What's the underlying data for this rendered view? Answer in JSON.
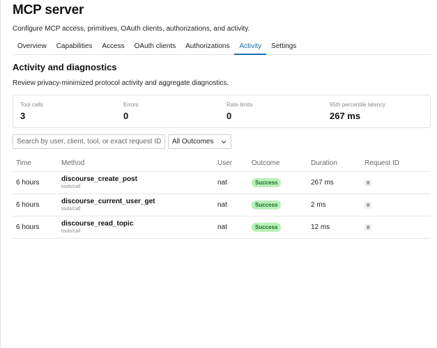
{
  "page": {
    "title": "MCP server",
    "description": "Configure MCP access, primitives, OAuth clients, authorizations, and activity."
  },
  "tabs": [
    {
      "label": "Overview",
      "active": false
    },
    {
      "label": "Capabilities",
      "active": false
    },
    {
      "label": "Access",
      "active": false
    },
    {
      "label": "OAuth clients",
      "active": false
    },
    {
      "label": "Authorizations",
      "active": false
    },
    {
      "label": "Activity",
      "active": true
    },
    {
      "label": "Settings",
      "active": false
    }
  ],
  "section": {
    "title": "Activity and diagnostics",
    "description": "Review privacy-minimized protocol activity and aggregate diagnostics."
  },
  "stats": [
    {
      "label": "Tool calls",
      "value": "3"
    },
    {
      "label": "Errors",
      "value": "0"
    },
    {
      "label": "Rate limits",
      "value": "0"
    },
    {
      "label": "95th percentile latency",
      "value": "267 ms"
    }
  ],
  "filters": {
    "search_placeholder": "Search by user, client, tool, or exact request ID",
    "search_value": "",
    "outcome_selected": "All Outcomes",
    "chevron_icon": "chevron-down-icon"
  },
  "table": {
    "columns": [
      "Time",
      "Method",
      "User",
      "Outcome",
      "Duration",
      "Request ID"
    ],
    "rows": [
      {
        "time": "6 hours",
        "method": "discourse_create_post",
        "method_type": "tools/call",
        "user": "nat",
        "outcome": "Success",
        "duration": "267 ms",
        "request_id": "0"
      },
      {
        "time": "6 hours",
        "method": "discourse_current_user_get",
        "method_type": "tools/call",
        "user": "nat",
        "outcome": "Success",
        "duration": "2 ms",
        "request_id": "0"
      },
      {
        "time": "6 hours",
        "method": "discourse_read_topic",
        "method_type": "tools/call",
        "user": "nat",
        "outcome": "Success",
        "duration": "12 ms",
        "request_id": "0"
      }
    ]
  },
  "colors": {
    "accent": "#1b6fae",
    "success_bg": "#b9f0b9",
    "success_text": "#1e6b2a"
  }
}
